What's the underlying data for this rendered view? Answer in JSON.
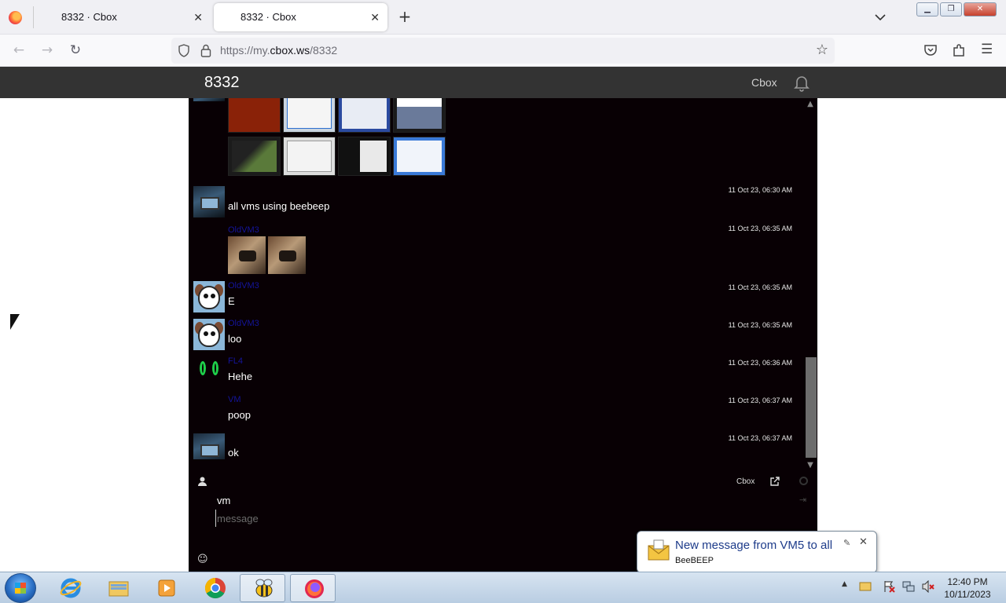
{
  "browser": {
    "tabs": [
      {
        "title": "8332 · Cbox"
      },
      {
        "title": "8332 · Cbox"
      }
    ],
    "url_prefix": "https://my.",
    "url_host": "cbox.ws",
    "url_path": "/8332"
  },
  "site": {
    "title": "8332",
    "nav_link": "Cbox"
  },
  "chat": {
    "messages": [
      {
        "name": "",
        "text": "all vms using beebeep",
        "time": "11 Oct 23, 06:30 AM"
      },
      {
        "name": "OldVM3",
        "text": "",
        "time": "11 Oct 23, 06:35 AM"
      },
      {
        "name": "OldVM3",
        "text": "E",
        "time": "11 Oct 23, 06:35 AM"
      },
      {
        "name": "OldVM3",
        "text": "loo",
        "time": "11 Oct 23, 06:35 AM"
      },
      {
        "name": "FL4",
        "text": "Hehe",
        "time": "11 Oct 23, 06:36 AM"
      },
      {
        "name": "VM",
        "text": "poop",
        "time": "11 Oct 23, 06:37 AM"
      },
      {
        "name": "",
        "text": "ok",
        "time": "11 Oct 23, 06:37 AM"
      }
    ],
    "toolbar": {
      "brand": "Cbox"
    },
    "composer": {
      "name": "vm",
      "placeholder": "message"
    }
  },
  "notification": {
    "title": "New message from VM5 to all",
    "app": "BeeBEEP"
  },
  "taskbar": {
    "clock_time": "12:40 PM",
    "clock_date": "10/11/2023"
  },
  "colors": {
    "chat_bg": "#080004",
    "header_bg": "#333333",
    "username": "#14149a"
  }
}
